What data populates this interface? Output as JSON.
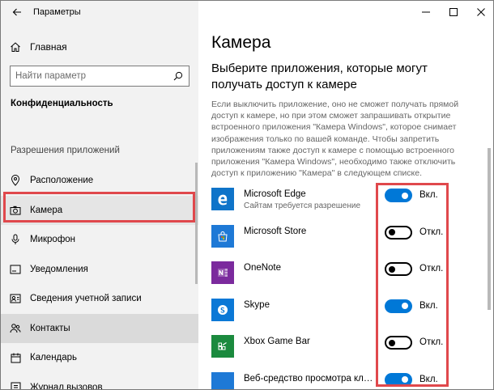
{
  "window": {
    "title": "Параметры"
  },
  "sidebar": {
    "home_label": "Главная",
    "search_placeholder": "Найти параметр",
    "section_title": "Конфиденциальность",
    "group_label": "Разрешения приложений",
    "items": [
      {
        "label": "Расположение",
        "icon": "location-icon"
      },
      {
        "label": "Камера",
        "icon": "camera-icon",
        "selected": true
      },
      {
        "label": "Микрофон",
        "icon": "microphone-icon"
      },
      {
        "label": "Уведомления",
        "icon": "notifications-icon"
      },
      {
        "label": "Сведения учетной записи",
        "icon": "account-info-icon"
      },
      {
        "label": "Контакты",
        "icon": "contacts-icon"
      },
      {
        "label": "Календарь",
        "icon": "calendar-icon"
      },
      {
        "label": "Журнал вызовов",
        "icon": "call-history-icon"
      }
    ]
  },
  "main": {
    "title": "Камера",
    "subtitle": "Выберите приложения, которые могут получать доступ к камере",
    "description": "Если выключить приложение, оно не сможет получать прямой доступ к камере, но при этом сможет запрашивать открытие встроенного приложения \"Камера Windows\", которое снимает изображения только по вашей команде. Чтобы запретить приложениям также доступ к камере с помощью встроенного приложения \"Камера Windows\", необходимо также отключить доступ к приложению \"Камера\" в следующем списке.",
    "apps": [
      {
        "name": "Microsoft Edge",
        "sub": "Сайтам требуется разрешение",
        "state": "Вкл.",
        "on": true,
        "icon": "edge-icon",
        "color": "#0f74c9"
      },
      {
        "name": "Microsoft Store",
        "sub": "",
        "state": "Откл.",
        "on": false,
        "icon": "store-icon",
        "color": "#1e79d6"
      },
      {
        "name": "OneNote",
        "sub": "",
        "state": "Откл.",
        "on": false,
        "icon": "onenote-icon",
        "color": "#7b2a9d"
      },
      {
        "name": "Skype",
        "sub": "",
        "state": "Вкл.",
        "on": true,
        "icon": "skype-icon",
        "color": "#0b78d6"
      },
      {
        "name": "Xbox Game Bar",
        "sub": "",
        "state": "Откл.",
        "on": false,
        "icon": "xbox-game-bar-icon",
        "color": "#1b8a3e"
      },
      {
        "name": "Веб-средство просмотра классических приложений",
        "sub": "",
        "state": "Вкл.",
        "on": true,
        "icon": "web-viewer-icon",
        "color": "#1e79d6"
      }
    ]
  },
  "colors": {
    "accent": "#0078d7",
    "highlight": "#e0484c",
    "sidebar_bg": "#f2f2f2"
  }
}
